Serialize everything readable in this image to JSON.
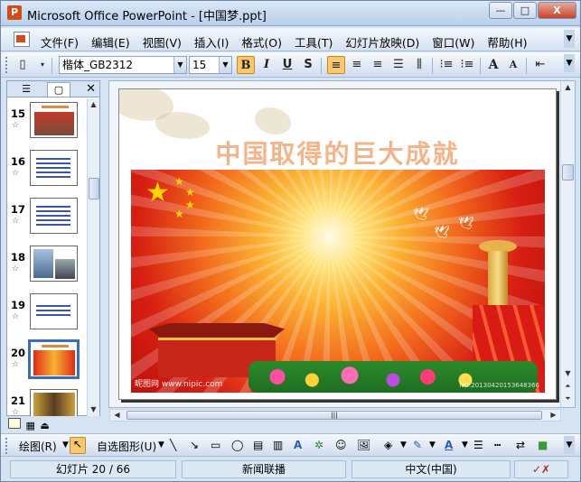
{
  "window": {
    "title": "Microsoft Office PowerPoint - [中国梦.ppt]",
    "app_icon_letter": "P",
    "controls": {
      "minimize": "—",
      "maximize": "□",
      "close": "X"
    }
  },
  "menubar": {
    "items": [
      "文件(F)",
      "编辑(E)",
      "视图(V)",
      "插入(I)",
      "格式(O)",
      "工具(T)",
      "幻灯片放映(D)",
      "窗口(W)",
      "帮助(H)"
    ]
  },
  "format_toolbar": {
    "font_name": "楷体_GB2312",
    "font_size": "15",
    "bold_label": "B",
    "italic_label": "I",
    "underline_label": "U",
    "shadow_label": "S",
    "grow_font_label": "A",
    "shrink_font_label": "A"
  },
  "outline_pane": {
    "slides": [
      {
        "number": "15"
      },
      {
        "number": "16"
      },
      {
        "number": "17"
      },
      {
        "number": "18"
      },
      {
        "number": "19"
      },
      {
        "number": "20"
      },
      {
        "number": "21"
      }
    ],
    "selected_slide": "20",
    "star_glyph": "☆"
  },
  "slide": {
    "title": "中国取得的巨大成就",
    "watermark_left": "昵图网 www.nipic.com",
    "watermark_right": "NO:20130420153648366"
  },
  "draw_toolbar": {
    "draw_label": "绘图(R)",
    "autoshape_label": "自选图形(U)"
  },
  "statusbar": {
    "slide_indicator": "幻灯片 20 / 66",
    "design_name": "新闻联播",
    "language": "中文(中国)"
  },
  "colors": {
    "title_bar": "#c4d7ee",
    "slide_title": "#f2b488",
    "selected_border": "#3a6fb8"
  }
}
